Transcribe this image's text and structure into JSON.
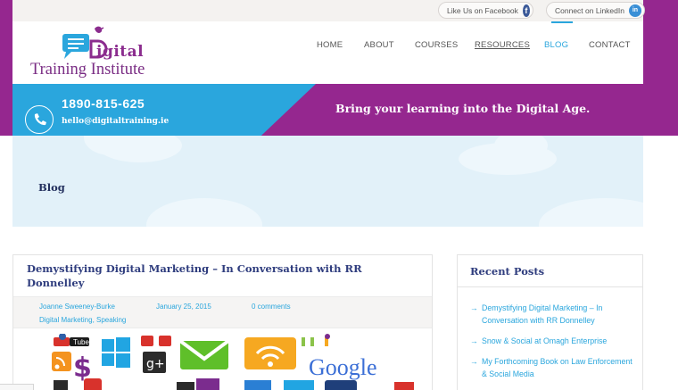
{
  "topbar": {
    "facebook_label": "Like Us on Facebook",
    "facebook_icon": "facebook-icon",
    "linkedin_label": "Connect on LinkedIn",
    "linkedin_icon": "linkedin-icon"
  },
  "logo": {
    "word": "igital",
    "sub": "Training Institute"
  },
  "nav": {
    "items": [
      {
        "label": "HOME"
      },
      {
        "label": "ABOUT"
      },
      {
        "label": "COURSES"
      },
      {
        "label": "RESOURCES"
      },
      {
        "label": "BLOG"
      },
      {
        "label": "CONTACT"
      }
    ],
    "active": "BLOG"
  },
  "contact": {
    "phone": "1890-815-625",
    "email": "hello@digitaltraining.ie",
    "phone_icon": "phone-icon",
    "tagline": "Bring your learning into the Digital Age."
  },
  "hero": {
    "title": "Blog"
  },
  "post": {
    "title": "Demystifying Digital Marketing – In Conversation with RR Donnelley",
    "author": "Joanne Sweeney-Burke",
    "date": "January 25, 2015",
    "comments": "0 comments",
    "categories": "Digital Marketing, Speaking",
    "image_words": {
      "tube": "Tube",
      "gplus": "g+",
      "google": "Google"
    }
  },
  "sidebar": {
    "title": "Recent Posts",
    "items": [
      {
        "label": "Demystifying Digital Marketing – In Conversation with RR Donnelley"
      },
      {
        "label": "Snow & Social at Omagh Enterprise"
      },
      {
        "label": "My Forthcoming Book on Law Enforcement & Social Media"
      }
    ]
  },
  "colors": {
    "brand_purple": "#95278f",
    "brand_blue": "#2aa6dd",
    "heading_navy": "#2f3d7e"
  }
}
